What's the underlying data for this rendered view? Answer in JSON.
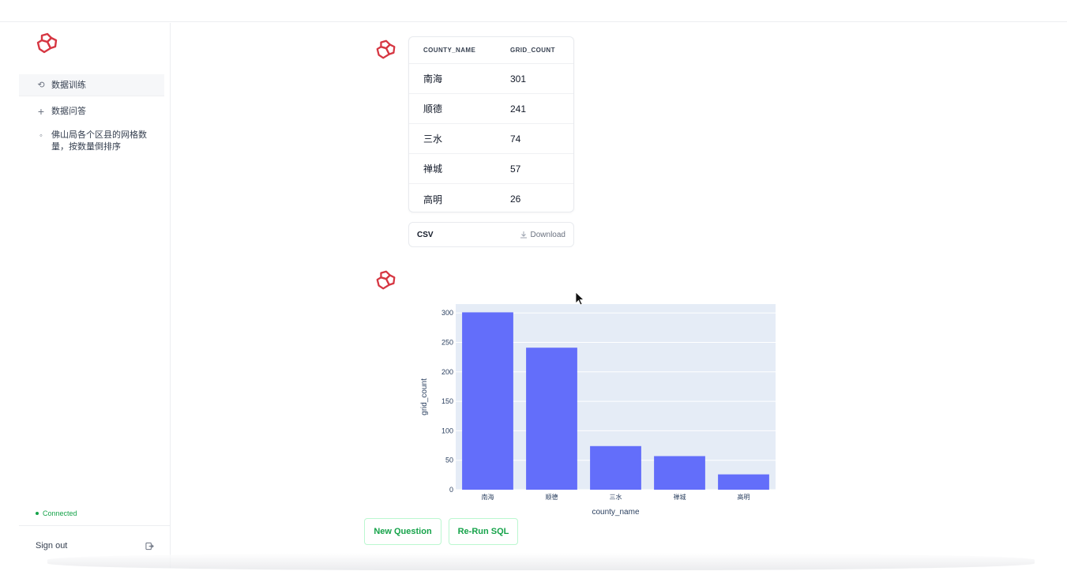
{
  "sidebar": {
    "items": [
      {
        "icon": "⟲",
        "label": "数据训练"
      },
      {
        "icon": "+",
        "label": "数据问答"
      },
      {
        "icon": "◦",
        "label": "佛山局各个区县的网格数量，按数量倒排序"
      }
    ],
    "status": "Connected",
    "signout": "Sign out"
  },
  "table": {
    "headers": [
      "COUNTY_NAME",
      "GRID_COUNT"
    ],
    "rows": [
      [
        "南海",
        "301"
      ],
      [
        "顺德",
        "241"
      ],
      [
        "三水",
        "74"
      ],
      [
        "禅城",
        "57"
      ],
      [
        "高明",
        "26"
      ]
    ]
  },
  "csv": {
    "label": "CSV",
    "download": "Download"
  },
  "chart_data": {
    "type": "bar",
    "categories": [
      "南海",
      "顺德",
      "三水",
      "禅城",
      "高明"
    ],
    "values": [
      301,
      241,
      74,
      57,
      26
    ],
    "xlabel": "county_name",
    "ylabel": "grid_count",
    "ylim": [
      0,
      315
    ],
    "yticks": [
      0,
      50,
      100,
      150,
      200,
      250,
      300
    ],
    "bar_color": "#636efa",
    "plot_bg": "#e5ecf6"
  },
  "buttons": {
    "new_question": "New Question",
    "rerun_sql": "Re-Run SQL"
  },
  "colors": {
    "brand": "#d63642",
    "success": "#16a34a"
  }
}
